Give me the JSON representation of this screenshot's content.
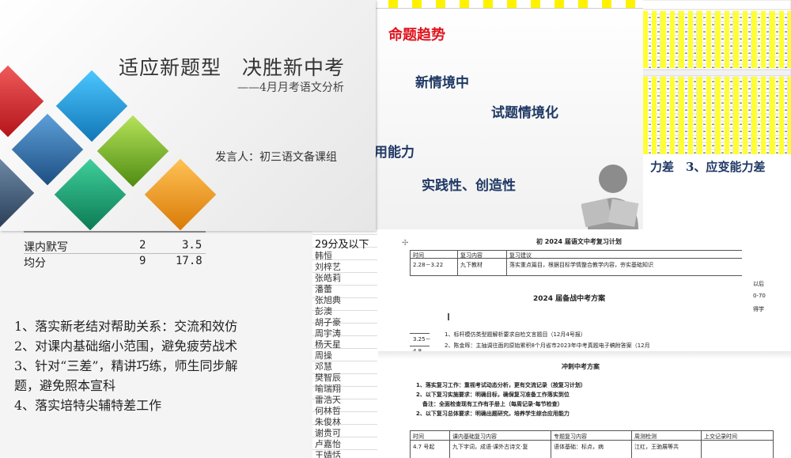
{
  "slide_title": {
    "title": "适应新题型　决胜新中考",
    "subtitle": "——4月月考语文分析",
    "speaker": "发言人：初三语文备课组"
  },
  "slide_trend": {
    "heading": "命题趋势",
    "items": [
      "新情境中",
      "试题情境化",
      "用能力",
      "实践性、创造性"
    ]
  },
  "sheet": {
    "tail_text": "力差　3、应变能力差",
    "header_color": "#ffff00"
  },
  "slide_measures": {
    "table_rows": [
      {
        "label": "课内默写",
        "a": "2",
        "b": "3.5"
      },
      {
        "label": "均分",
        "a": "9",
        "b": "17.8"
      }
    ],
    "bullets": [
      "1、落实新老结对帮助关系：交流和效仿",
      "2、对课内基础缩小范围，避免疲劳战术",
      "3、针对“三差”，精讲巧练，师生同步解",
      "题，避免照本宣科",
      "4、落实培特尖辅特差工作"
    ]
  },
  "names_sheet": {
    "header": "29分及以下",
    "names": [
      "韩恒",
      "刘梓艺",
      "张皓莉",
      "潘蕾",
      "张旭典",
      "彭澳",
      "胡子豪",
      "周宇涛",
      "杨天星",
      "周操",
      "邓慧",
      "樊智辰",
      "喻瑞翔",
      "雷浩天",
      "何林哲",
      "朱俊林",
      "谢贵可",
      "卢嘉怡",
      "王婧恬"
    ]
  },
  "doc": {
    "top_title": "初 2024 届语文中考复习计划",
    "col_time": "时间",
    "col_content": "复习内容",
    "col_advice": "复习建议",
    "row1_time": "2.28－3.22",
    "row1_content": "九下教材",
    "row1_advice": "落实重点篇目，根据目标学情整合教学内容，夯实基础知识",
    "plan_title": "2024 届备战中考方案",
    "row2_time": "3.25－",
    "row3_time": "4.8",
    "notes": [
      "1、标杆模仿类型题解析要求自检文言题目（12月4号报）",
      "2、陈金晖：主抽调往面的原始累积8个月省市2023年中考真题电子稿附答案（12月"
    ],
    "side_text": [
      "以后",
      "0-70",
      "得学"
    ],
    "sub_heading": "冲刺中考方案",
    "points": [
      "1、落实复习工作：重视考试动态分析，更有交流记录（按复习计划）",
      "2、以下复习实施要求：明确目标，确保复习准备工作落实到位",
      "备注：全面检查现有工作有手册上（每周记录·每节检查）",
      "2、以下复习总体要求：明确出题研究，培养学生综合应用能力"
    ],
    "bottom_headers": [
      "时间",
      "课内基础复习内容",
      "专题复习内容",
      "周测检测",
      "上交记录时间"
    ],
    "bottom_row": {
      "time": "4.7 号起",
      "content": "九下字词，成语·课外古诗文·复",
      "topic": "语体基础：标点，病",
      "test": "江红，王驰展等共"
    }
  }
}
